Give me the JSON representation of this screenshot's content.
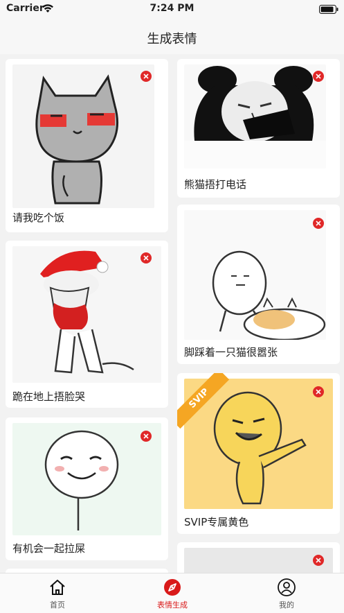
{
  "status_bar": {
    "carrier": "Carrier",
    "time": "7:24 PM"
  },
  "nav": {
    "title": "生成表情"
  },
  "cards": [
    {
      "caption": "请我吃个饭"
    },
    {
      "caption": "熊猫捂打电话"
    },
    {
      "caption": "脚踩着一只猫很嚣张"
    },
    {
      "caption": "跪在地上捂脸哭"
    },
    {
      "caption": "SVIP专属黄色",
      "badge": "SVIP"
    },
    {
      "caption": "有机会一起拉屎"
    }
  ],
  "tabs": [
    {
      "label": "首页",
      "icon": "home-icon"
    },
    {
      "label": "表情生成",
      "icon": "compass-icon",
      "active": true
    },
    {
      "label": "我的",
      "icon": "user-icon"
    }
  ],
  "colors": {
    "accent": "#d91a1a",
    "background": "#f2f2f2",
    "card": "#ffffff",
    "svip_badge": "#f5a623"
  }
}
